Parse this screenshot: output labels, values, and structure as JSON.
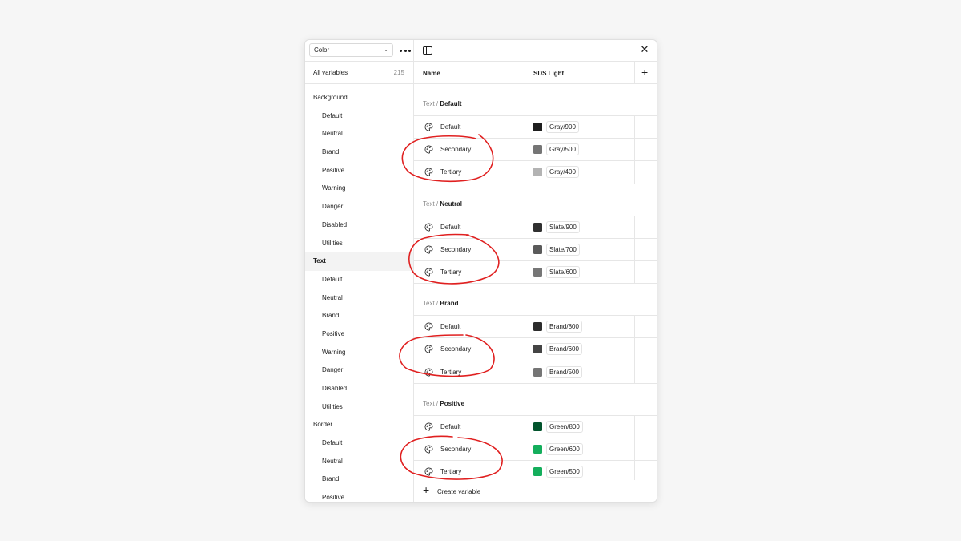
{
  "sidebar": {
    "collection": "Color",
    "all_variables_label": "All variables",
    "all_variables_count": "215",
    "groups": [
      {
        "label": "Background",
        "type": "group"
      },
      {
        "label": "Default",
        "type": "child"
      },
      {
        "label": "Neutral",
        "type": "child"
      },
      {
        "label": "Brand",
        "type": "child"
      },
      {
        "label": "Positive",
        "type": "child"
      },
      {
        "label": "Warning",
        "type": "child"
      },
      {
        "label": "Danger",
        "type": "child"
      },
      {
        "label": "Disabled",
        "type": "child"
      },
      {
        "label": "Utilities",
        "type": "child"
      },
      {
        "label": "Text",
        "type": "group",
        "active": true
      },
      {
        "label": "Default",
        "type": "child"
      },
      {
        "label": "Neutral",
        "type": "child"
      },
      {
        "label": "Brand",
        "type": "child"
      },
      {
        "label": "Positive",
        "type": "child"
      },
      {
        "label": "Warning",
        "type": "child"
      },
      {
        "label": "Danger",
        "type": "child"
      },
      {
        "label": "Disabled",
        "type": "child"
      },
      {
        "label": "Utilities",
        "type": "child"
      },
      {
        "label": "Border",
        "type": "group"
      },
      {
        "label": "Default",
        "type": "child"
      },
      {
        "label": "Neutral",
        "type": "child"
      },
      {
        "label": "Brand",
        "type": "child"
      },
      {
        "label": "Positive",
        "type": "child"
      }
    ]
  },
  "table": {
    "col_name": "Name",
    "col_mode": "SDS Light",
    "sections": [
      {
        "prefix": "Text",
        "separator": "/",
        "group": "Default",
        "rows": [
          {
            "name": "Default",
            "value": "Gray/900",
            "swatch": "#1e1e1e"
          },
          {
            "name": "Secondary",
            "value": "Gray/500",
            "swatch": "#757575"
          },
          {
            "name": "Tertiary",
            "value": "Gray/400",
            "swatch": "#b3b3b3"
          }
        ]
      },
      {
        "prefix": "Text",
        "separator": "/",
        "group": "Neutral",
        "rows": [
          {
            "name": "Default",
            "value": "Slate/900",
            "swatch": "#303030"
          },
          {
            "name": "Secondary",
            "value": "Slate/700",
            "swatch": "#5a5a5a"
          },
          {
            "name": "Tertiary",
            "value": "Slate/600",
            "swatch": "#767676"
          }
        ]
      },
      {
        "prefix": "Text",
        "separator": "/",
        "group": "Brand",
        "rows": [
          {
            "name": "Default",
            "value": "Brand/800",
            "swatch": "#2c2c2c"
          },
          {
            "name": "Secondary",
            "value": "Brand/600",
            "swatch": "#444444"
          },
          {
            "name": "Tertiary",
            "value": "Brand/500",
            "swatch": "#757575"
          }
        ]
      },
      {
        "prefix": "Text",
        "separator": "/",
        "group": "Positive",
        "rows": [
          {
            "name": "Default",
            "value": "Green/800",
            "swatch": "#02542d"
          },
          {
            "name": "Secondary",
            "value": "Green/600",
            "swatch": "#14ae5c"
          },
          {
            "name": "Tertiary",
            "value": "Green/500",
            "swatch": "#14ae5c"
          }
        ]
      }
    ],
    "create_label": "Create variable"
  },
  "colors": {
    "annotation": "#e02020"
  }
}
